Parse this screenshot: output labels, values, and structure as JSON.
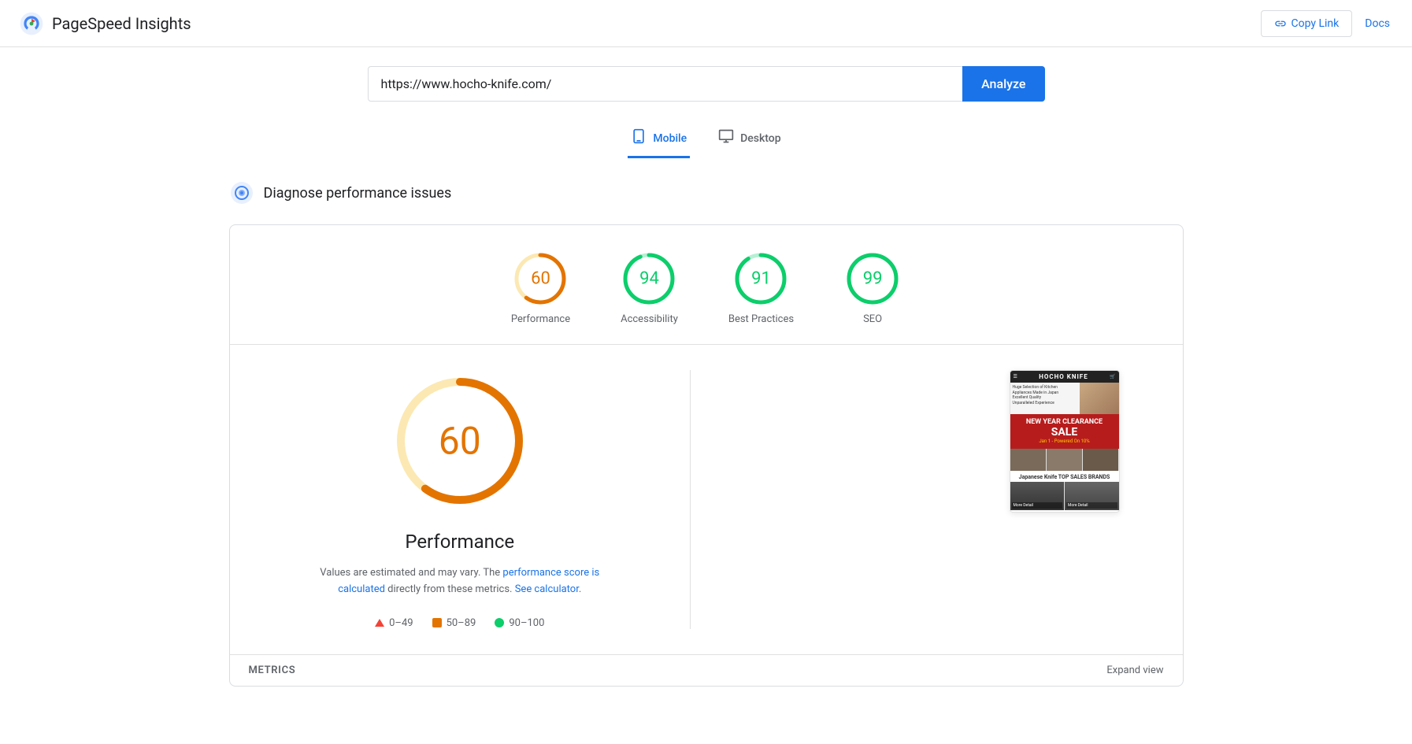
{
  "header": {
    "title": "PageSpeed Insights",
    "copy_link_label": "Copy Link",
    "docs_label": "Docs"
  },
  "url_bar": {
    "value": "https://www.hocho-knife.com/",
    "placeholder": "Enter a web page URL",
    "analyze_label": "Analyze"
  },
  "tabs": [
    {
      "id": "mobile",
      "label": "Mobile",
      "active": true
    },
    {
      "id": "desktop",
      "label": "Desktop",
      "active": false
    }
  ],
  "diagnose": {
    "title": "Diagnose performance issues"
  },
  "scores": [
    {
      "id": "performance",
      "value": "60",
      "label": "Performance",
      "color": "#e37400",
      "track_color": "#fce8b2",
      "pct": 60
    },
    {
      "id": "accessibility",
      "value": "94",
      "label": "Accessibility",
      "color": "#0cce6b",
      "track_color": "#b7f0d4",
      "pct": 94
    },
    {
      "id": "best-practices",
      "value": "91",
      "label": "Best Practices",
      "color": "#0cce6b",
      "track_color": "#b7f0d4",
      "pct": 91
    },
    {
      "id": "seo",
      "value": "99",
      "label": "SEO",
      "color": "#0cce6b",
      "track_color": "#b7f0d4",
      "pct": 99
    }
  ],
  "performance_detail": {
    "score": "60",
    "title": "Performance",
    "description_start": "Values are estimated and may vary. The",
    "description_link1": "performance score is calculated",
    "description_mid": "directly from these metrics.",
    "description_link2": "See calculator",
    "description_end": "."
  },
  "legend": [
    {
      "type": "triangle",
      "range": "0–49"
    },
    {
      "type": "square",
      "range": "50–89"
    },
    {
      "type": "circle",
      "range": "90–100"
    }
  ],
  "metrics_bar": {
    "label": "METRICS",
    "expand_label": "Expand view"
  },
  "preview": {
    "site_name": "HOCHO KNIFE",
    "sale_text": "NEW YEAR CLEARANCE SALE",
    "brands_title": "Japanese Knife TOP SALES BRANDS"
  }
}
